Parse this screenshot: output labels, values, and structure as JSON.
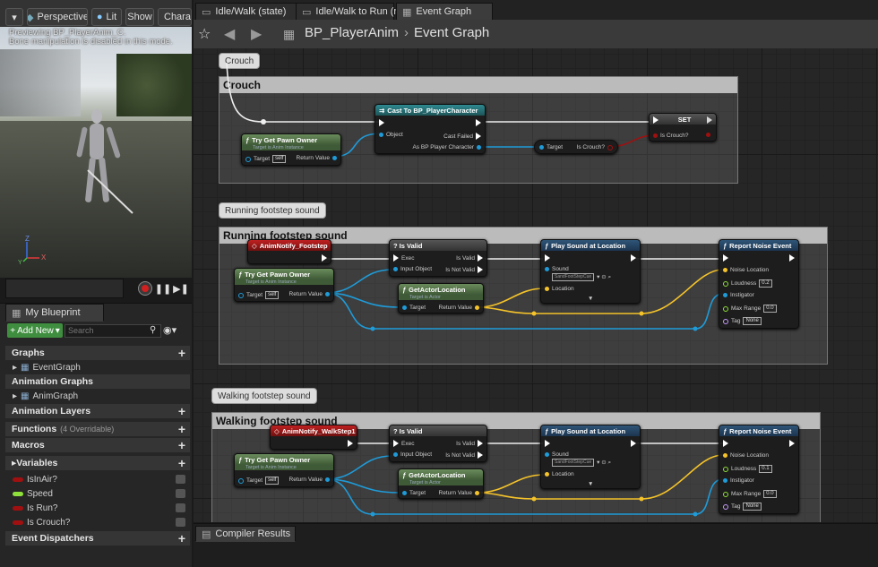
{
  "viewport": {
    "buttons": {
      "perspective": "Perspective",
      "lit": "Lit",
      "show": "Show",
      "character": "Character"
    },
    "message_line1": "Previewing BP_PlayerAnim_C.",
    "message_line2": "Bone manipulation is disabled in this mode.",
    "axis": {
      "z": "Z",
      "x": "X",
      "y": "Y"
    }
  },
  "my_blueprint": {
    "tab": "My Blueprint",
    "add_new": "Add New",
    "search_placeholder": "Search",
    "sections": {
      "graphs": "Graphs",
      "event_graph": "EventGraph",
      "animation_graphs": "Animation Graphs",
      "anim_graph": "AnimGraph",
      "animation_layers": "Animation Layers",
      "functions": "Functions",
      "functions_count": "(4 Overridable)",
      "macros": "Macros",
      "variables": "Variables",
      "event_dispatchers": "Event Dispatchers"
    },
    "variables": [
      {
        "name": "IsInAir?",
        "color": "#a01010"
      },
      {
        "name": "Speed",
        "color": "#8fe03a"
      },
      {
        "name": "Is Run?",
        "color": "#a01010"
      },
      {
        "name": "Is Crouch?",
        "color": "#a01010"
      }
    ]
  },
  "tabs": [
    "Idle/Walk (state)",
    "Idle/Walk to Run (r",
    "Event Graph"
  ],
  "breadcrumb": {
    "blueprint": "BP_PlayerAnim",
    "graph": "Event Graph"
  },
  "comments": {
    "crouch": "Crouch",
    "running": "Running footstep sound",
    "walking": "Walking footstep sound"
  },
  "nodes": {
    "try_get_pawn_owner": {
      "title": "Try Get Pawn Owner",
      "sub": "Target is Anim Instance",
      "target": "Target",
      "self": "self",
      "return": "Return Value"
    },
    "cast": {
      "title": "Cast To BP_PlayerCharacter",
      "object": "Object",
      "cast_failed": "Cast Failed",
      "as": "As BP Player Character"
    },
    "get_crouch": {
      "target": "Target",
      "output": "Is Crouch?"
    },
    "set": {
      "title": "SET",
      "pin": "Is Crouch?"
    },
    "notify_footstep": "AnimNotify_Footstep",
    "notify_walkstep": "AnimNotify_WalkStep1",
    "is_valid": {
      "title": "? Is Valid",
      "exec": "Exec",
      "input": "Input Object",
      "is_valid": "Is Valid",
      "not_valid": "Is Not Valid"
    },
    "get_actor_location": {
      "title": "GetActorLocation",
      "sub": "Target is Actor",
      "target": "Target",
      "return": "Return Value"
    },
    "play_sound": {
      "title": "Play Sound at Location",
      "sound": "Sound",
      "asset": "SandFootStepCue",
      "location": "Location"
    },
    "report_noise": {
      "title": "Report Noise Event",
      "noise_location": "Noise Location",
      "loudness": "Loudness",
      "instigator": "Instigator",
      "max_range": "Max Range",
      "tag": "Tag",
      "none": "None"
    },
    "loudness_running": "0.2",
    "loudness_walking": "0.1",
    "max_range_value": "0.0"
  },
  "compiler": {
    "tab": "Compiler Results"
  },
  "colors": {
    "exec": "#ffffff",
    "object": "#1f9bd8",
    "vector": "#f5c32a",
    "bool": "#a01010",
    "float": "#8fe03a",
    "function_header": "#5a7a4e",
    "cast_header": "#2a6a6e",
    "event_header": "#8a1818",
    "play_sound_header": "#2a4a6a"
  }
}
